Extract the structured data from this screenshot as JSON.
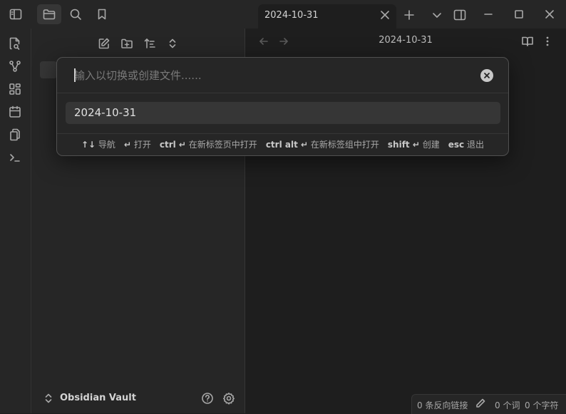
{
  "tab": {
    "title": "2024-10-31"
  },
  "main": {
    "title": "2024-10-31"
  },
  "vault": {
    "name": "Obsidian Vault"
  },
  "status": {
    "backlinks": "0 条反向链接",
    "words": "0 个词",
    "chars": "0 个字符"
  },
  "switcher": {
    "placeholder": "输入以切换或创建文件......",
    "suggestion": "2024-10-31",
    "instructions": [
      {
        "key": "↑↓",
        "label": "导航"
      },
      {
        "key": "↵",
        "label": "打开"
      },
      {
        "key": "ctrl ↵",
        "label": "在新标签页中打开"
      },
      {
        "key": "ctrl alt ↵",
        "label": "在新标签组中打开"
      },
      {
        "key": "shift ↵",
        "label": "创建"
      },
      {
        "key": "esc",
        "label": "退出"
      }
    ]
  },
  "colors": {
    "background": "#1e1e1e",
    "sidebar": "#262626",
    "selection": "#363636"
  }
}
